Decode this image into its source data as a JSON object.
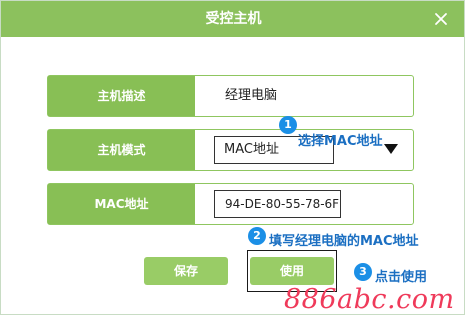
{
  "dialog": {
    "title": "受控主机",
    "close_icon": "close-icon"
  },
  "rows": {
    "description": {
      "label": "主机描述",
      "value": "经理电脑"
    },
    "mode": {
      "label": "主机模式",
      "selected": "MAC地址",
      "dropdown_icon": "triangle-down-icon"
    },
    "mac": {
      "label": "MAC地址",
      "value": "94-DE-80-55-78-6F"
    }
  },
  "buttons": {
    "save": "保存",
    "use": "使用"
  },
  "annotations": [
    {
      "number": "1",
      "text": "选择MAC地址"
    },
    {
      "number": "2",
      "text": "填写经理电脑的MAC地址"
    },
    {
      "number": "3",
      "text": "点击使用"
    }
  ],
  "watermark": "886abc.com",
  "colors": {
    "titlebar": "#8cc15d",
    "label_bg": "#88bf55",
    "button_bg": "#99cc66",
    "annotation_blue": "#1b6fc2",
    "watermark": "#ef3a5a"
  }
}
